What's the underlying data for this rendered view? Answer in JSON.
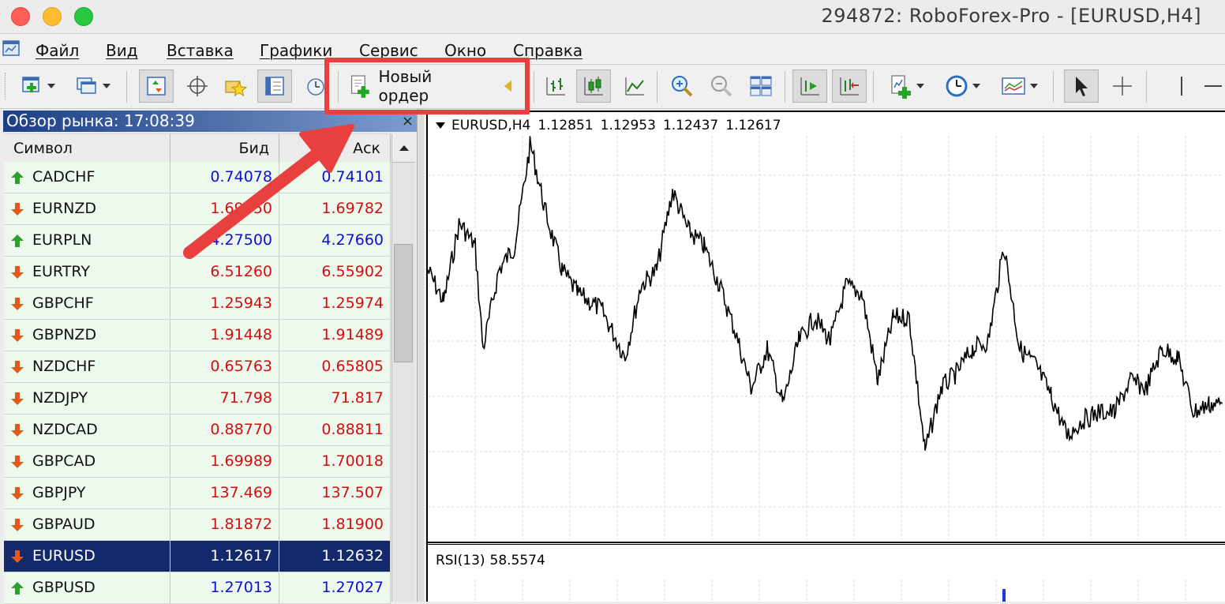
{
  "window": {
    "title": "294872: RoboForex-Pro - [EURUSD,H4]"
  },
  "menu": {
    "items": [
      "Файл",
      "Вид",
      "Вставка",
      "Графики",
      "Сервис",
      "Окно",
      "Справка"
    ]
  },
  "toolbar": {
    "new_order_label": "Новый ордер",
    "icons": [
      "new-chart-icon",
      "profiles-icon",
      "market-watch-icon",
      "crosshair-data-icon",
      "favorites-icon",
      "terminal-icon",
      "strategy-tester-icon",
      "bar-chart-icon",
      "candlestick-icon",
      "line-chart-icon",
      "zoom-in-icon",
      "zoom-out-icon",
      "tile-windows-icon",
      "auto-scroll-icon",
      "chart-shift-icon",
      "indicators-icon",
      "periods-icon",
      "templates-icon",
      "cursor-icon",
      "crosshair-icon",
      "vertical-line-icon",
      "horizontal-line-icon"
    ]
  },
  "market_watch": {
    "header": "Обзор рынка: 17:08:39",
    "close_label": "×",
    "columns": {
      "symbol": "Символ",
      "bid": "Бид",
      "ask": "Аск"
    },
    "rows": [
      {
        "symbol": "CADCHF",
        "bid": "0.74078",
        "ask": "0.74101",
        "direction": "up",
        "price_color": "#1010d0"
      },
      {
        "symbol": "EURNZD",
        "bid": "1.69750",
        "ask": "1.69782",
        "direction": "down",
        "price_color": "#d01010"
      },
      {
        "symbol": "EURPLN",
        "bid": "4.27500",
        "ask": "4.27660",
        "direction": "up",
        "price_color": "#1010d0"
      },
      {
        "symbol": "EURTRY",
        "bid": "6.51260",
        "ask": "6.55902",
        "direction": "down",
        "price_color": "#d01010"
      },
      {
        "symbol": "GBPCHF",
        "bid": "1.25943",
        "ask": "1.25974",
        "direction": "down",
        "price_color": "#d01010"
      },
      {
        "symbol": "GBPNZD",
        "bid": "1.91448",
        "ask": "1.91489",
        "direction": "down",
        "price_color": "#d01010"
      },
      {
        "symbol": "NZDCHF",
        "bid": "0.65763",
        "ask": "0.65805",
        "direction": "down",
        "price_color": "#d01010"
      },
      {
        "symbol": "NZDJPY",
        "bid": "71.798",
        "ask": "71.817",
        "direction": "down",
        "price_color": "#d01010"
      },
      {
        "symbol": "NZDCAD",
        "bid": "0.88770",
        "ask": "0.88811",
        "direction": "down",
        "price_color": "#d01010"
      },
      {
        "symbol": "GBPCAD",
        "bid": "1.69989",
        "ask": "1.70018",
        "direction": "down",
        "price_color": "#d01010"
      },
      {
        "symbol": "GBPJPY",
        "bid": "137.469",
        "ask": "137.507",
        "direction": "down",
        "price_color": "#d01010"
      },
      {
        "symbol": "GBPAUD",
        "bid": "1.81872",
        "ask": "1.81900",
        "direction": "down",
        "price_color": "#d01010"
      },
      {
        "symbol": "EURUSD",
        "bid": "1.12617",
        "ask": "1.12632",
        "direction": "down",
        "price_color": "#ffffff",
        "selected": true
      },
      {
        "symbol": "GBPUSD",
        "bid": "1.27013",
        "ask": "1.27027",
        "direction": "up",
        "price_color": "#1010d0"
      }
    ]
  },
  "chart": {
    "symbol": "EURUSD,H4",
    "open": "1.12851",
    "high": "1.12953",
    "low": "1.12437",
    "close": "1.12617",
    "rsi_label": "RSI(13)",
    "rsi_value": "58.5574"
  },
  "colors": {
    "highlight": "#e8403f",
    "selected_row": "#13296b",
    "up_arrow": "#2ea02e",
    "down_arrow": "#e05a1a"
  }
}
